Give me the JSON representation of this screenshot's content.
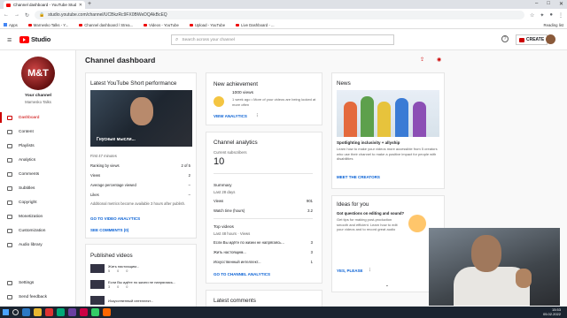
{
  "browser": {
    "tab_title": "Channel dashboard - YouTube Studio",
    "url": "studio.youtube.com/channel/UCBkzRc9FX0BWeDQAkBcEQ",
    "bookmarks": [
      "Apps",
      "Marnesko Talks - Y...",
      "Channel dashboard / Strea...",
      "Videos - YouTube",
      "Upload - YouTube",
      "Live Dashboard - ..."
    ],
    "reading_list": "Reading list"
  },
  "studio": {
    "logo": "Studio",
    "search_placeholder": "Search across your channel",
    "create_label": "CREATE"
  },
  "sidebar": {
    "channel_title": "Your channel",
    "channel_name": "Marnesko Talks",
    "avatar_text": "M&T",
    "items": [
      {
        "label": "Dashboard",
        "active": true
      },
      {
        "label": "Content"
      },
      {
        "label": "Playlists"
      },
      {
        "label": "Analytics"
      },
      {
        "label": "Comments"
      },
      {
        "label": "Subtitles"
      },
      {
        "label": "Copyright"
      },
      {
        "label": "Monetization"
      },
      {
        "label": "Customization"
      },
      {
        "label": "Audio library"
      }
    ],
    "settings": "Settings",
    "feedback": "Send feedback"
  },
  "page_title": "Channel dashboard",
  "short_card": {
    "title": "Latest YouTube Short performance",
    "caption": "Гнусные мысли...",
    "first_period": "First 47 minutes",
    "rows": [
      {
        "label": "Ranking by views",
        "value": "2 of 5"
      },
      {
        "label": "Views",
        "value": "2"
      },
      {
        "label": "Average percentage viewed",
        "value": "–"
      },
      {
        "label": "Likes",
        "value": "–"
      }
    ],
    "note": "Additional metrics become available 3 hours after publish.",
    "link_analytics": "GO TO VIDEO ANALYTICS",
    "link_comments": "SEE COMMENTS (0)"
  },
  "published_card": {
    "title": "Published videos",
    "videos": [
      {
        "title": "Жить настоящим...",
        "views": "5",
        "comments": "0",
        "likes": "0"
      },
      {
        "title": "Если Вы идёте по жизни не напрягаясь...",
        "views": "3",
        "comments": "0",
        "likes": "0"
      },
      {
        "title": "Искусственный интеллект...",
        "views": "",
        "comments": "",
        "likes": ""
      }
    ]
  },
  "achievement_card": {
    "title": "New achievement",
    "headline": "1000 views",
    "detail": "1 week ago • More of your videos are being looked at more often",
    "link": "VIEW ANALYTICS"
  },
  "analytics_card": {
    "title": "Channel analytics",
    "subs_label": "Current subscribers",
    "subs_value": "10",
    "summary_title": "Summary",
    "summary_period": "Last 28 days",
    "summary_rows": [
      {
        "label": "Views",
        "value": "901"
      },
      {
        "label": "Watch time (hours)",
        "value": "3.2"
      }
    ],
    "top_title": "Top videos",
    "top_period": "Last 48 hours · Views",
    "top_rows": [
      {
        "label": "Если Вы идёте по жизни не напрягаясь...",
        "value": "3"
      },
      {
        "label": "Жить настоящим...",
        "value": "3"
      },
      {
        "label": "Искусственный интеллект...",
        "value": "1"
      }
    ],
    "link": "GO TO CHANNEL ANALYTICS"
  },
  "comments_card": {
    "title": "Latest comments"
  },
  "news_card": {
    "title": "News",
    "headline": "Spotlighting inclusivity + allyship",
    "body": "Learn how to make your videos more accessible from 5 creators who use their channel to make a positive impact for people with disabilities",
    "link": "MEET THE CREATORS"
  },
  "ideas_card": {
    "title": "Ideas for you",
    "subtitle": "Got questions on editing and sound?",
    "body": "Get tips for making post-production smooth and efficient. Learn how to edit your videos and to record great audio",
    "link": "YES, PLEASE"
  },
  "taskbar": {
    "time": "15:53",
    "date": "05.02.2022"
  }
}
